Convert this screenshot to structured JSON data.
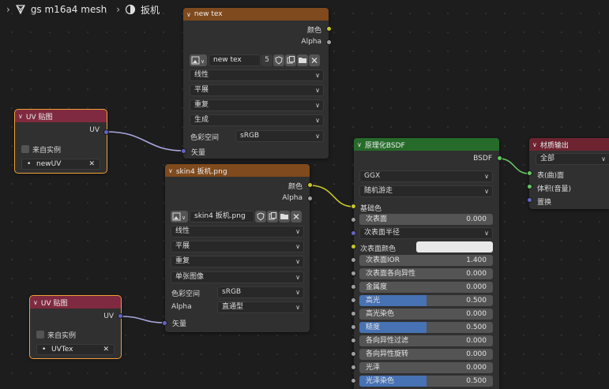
{
  "breadcrumb": {
    "mesh_name": "gs m16a4 mesh",
    "material_name": "扳机"
  },
  "node_newtex": {
    "title": "new tex",
    "out_color": "颜色",
    "out_alpha": "Alpha",
    "image_name": "new tex",
    "users": "5",
    "interpolation": "线性",
    "projection": "平展",
    "extension": "重复",
    "source": "生成",
    "colorspace_label": "色彩空间",
    "colorspace_value": "sRGB",
    "in_vector": "矢量"
  },
  "node_skin": {
    "title": "skin4 扳机.png",
    "out_color": "颜色",
    "out_alpha": "Alpha",
    "image_name": "skin4 扳机.png",
    "interpolation": "线性",
    "projection": "平展",
    "extension": "重复",
    "source": "单张图像",
    "colorspace_label": "色彩空间",
    "colorspace_value": "sRGB",
    "alpha_label": "Alpha",
    "alpha_value": "直通型",
    "in_vector": "矢量"
  },
  "node_uv1": {
    "title": "UV 贴图",
    "out_uv": "UV",
    "from_instancer": "来自实例",
    "uv_map": "newUV"
  },
  "node_uv2": {
    "title": "UV 贴图",
    "out_uv": "UV",
    "from_instancer": "来自实例",
    "uv_map": "UVTex"
  },
  "node_bsdf": {
    "title": "原理化BSDF",
    "out_bsdf": "BSDF",
    "distribution": "GGX",
    "subsurface_method": "随机游走",
    "base_color": "基础色",
    "subsurface_radius": "次表面半径",
    "subsurface_color": "次表面颜色",
    "sliders": [
      {
        "label": "次表面",
        "value": "0.000",
        "fill": 0.0
      },
      {
        "label": "次表面IOR",
        "value": "1.400",
        "fill": 0.0
      },
      {
        "label": "次表面各向异性",
        "value": "0.000",
        "fill": 0.0
      },
      {
        "label": "金属度",
        "value": "0.000",
        "fill": 0.0
      },
      {
        "label": "高光",
        "value": "0.500",
        "fill": 0.5
      },
      {
        "label": "高光染色",
        "value": "0.000",
        "fill": 0.0
      },
      {
        "label": "糙度",
        "value": "0.500",
        "fill": 0.5
      },
      {
        "label": "各向异性过滤",
        "value": "0.000",
        "fill": 0.0
      },
      {
        "label": "各向异性旋转",
        "value": "0.000",
        "fill": 0.0
      },
      {
        "label": "光泽",
        "value": "0.000",
        "fill": 0.0
      },
      {
        "label": "光泽染色",
        "value": "0.500",
        "fill": 0.5
      }
    ]
  },
  "node_output": {
    "title": "材质输出",
    "target": "全部",
    "in_surface": "表(曲)面",
    "in_volume": "体积(音量)",
    "in_displacement": "置换"
  }
}
